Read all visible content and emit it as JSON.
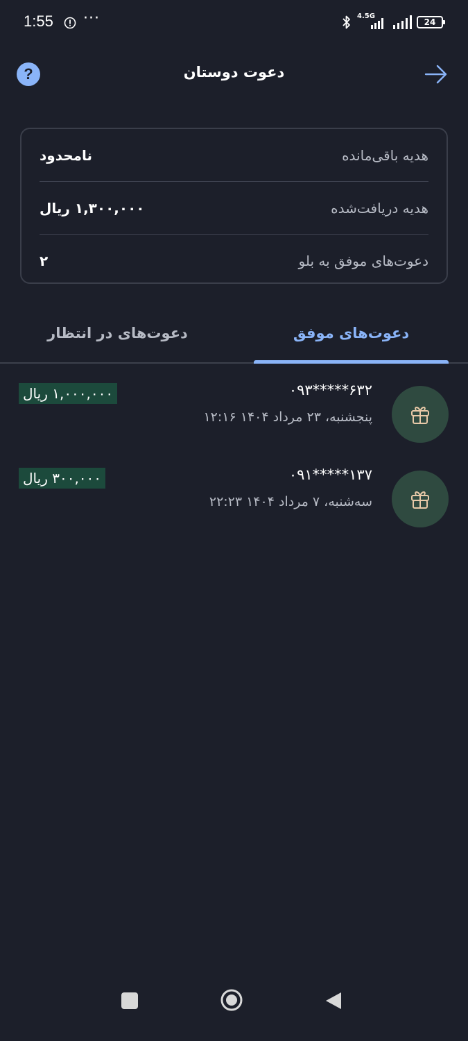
{
  "status_bar": {
    "time": "1:55",
    "dots": "···",
    "network": "4.5G",
    "battery": "24"
  },
  "header": {
    "title": "دعوت دوستان",
    "help_label": "?"
  },
  "summary": [
    {
      "label": "هدیه باقی‌مانده",
      "value": "نامحدود"
    },
    {
      "label": "هدیه دریافت‌شده",
      "value": "۱,۳۰۰,۰۰۰ ریال"
    },
    {
      "label": "دعوت‌های موفق به بلو",
      "value": "۲"
    }
  ],
  "tabs": {
    "successful": "دعوت‌های موفق",
    "pending": "دعوت‌های در انتظار"
  },
  "invites": [
    {
      "phone": "۰۹۳*****۶۳۲",
      "date": "پنجشنبه، ۲۳ مرداد ۱۴۰۴ ۱۲:۱۶",
      "amount": "۱,۰۰۰,۰۰۰ ریال"
    },
    {
      "phone": "۰۹۱*****۱۳۷",
      "date": "سه‌شنبه، ۷ مرداد ۱۴۰۴ ۲۲:۲۳",
      "amount": "۳۰۰,۰۰۰ ریال"
    }
  ],
  "colors": {
    "background": "#1c1f2a",
    "accent": "#8ab4f8",
    "gift_bg": "#2f4a40",
    "amount_bg": "#1c4a3c"
  },
  "icons": {
    "help": "help-icon",
    "back": "arrow-right-icon",
    "gift": "gift-icon"
  }
}
